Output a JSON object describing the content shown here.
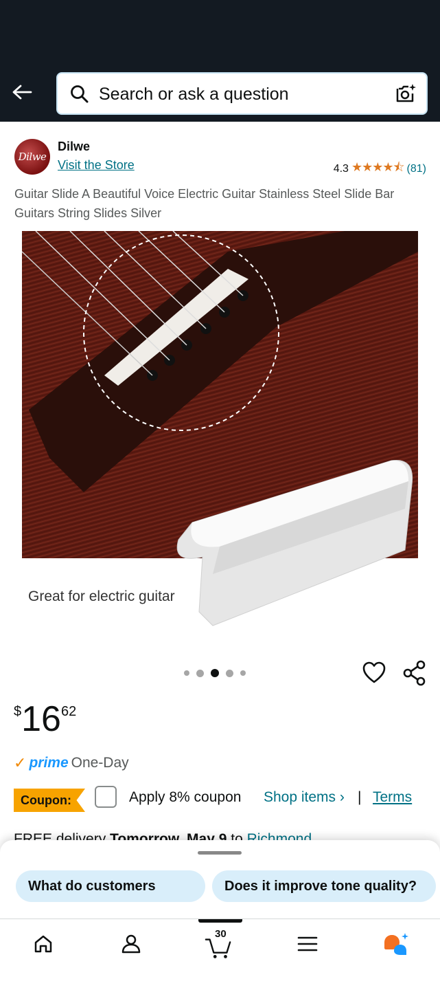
{
  "header": {
    "search_placeholder": "Search or ask a question",
    "icons": [
      "back-arrow-icon",
      "search-icon",
      "camera-icon"
    ]
  },
  "store": {
    "logo_text": "Dilwe",
    "name": "Dilwe",
    "visit_label": "Visit the Store",
    "rating_value": "4.3",
    "stars": "★★★★⯪",
    "rating_count": "(81)"
  },
  "product": {
    "title": "Guitar Slide A Beautiful Voice Electric Guitar Stainless Steel Slide Bar Guitars String Slides Silver",
    "image_caption": "Great for electric guitar",
    "carousel": {
      "total": 5,
      "active_index": 2
    }
  },
  "price": {
    "symbol": "$",
    "whole": "16",
    "fraction": "62"
  },
  "prime": {
    "check": "✓",
    "word": "prime",
    "tier": "One-Day"
  },
  "coupon": {
    "badge": "Coupon:",
    "apply_text": "Apply 8% coupon",
    "shop_items": "Shop items ›",
    "separator": "|",
    "terms": "Terms"
  },
  "delivery": {
    "prefix": "FREE delivery ",
    "date": "Tomorrow, May 9",
    "to": " to ",
    "location": "Richmond"
  },
  "suggestions": {
    "chip1": "What do customers",
    "chip2": "Does it improve tone quality?"
  },
  "bottom_nav": {
    "cart_count": "30",
    "items": [
      "home-icon",
      "account-icon",
      "cart-icon",
      "menu-icon",
      "rufus-icon"
    ]
  },
  "colors": {
    "header_bg": "#131a22",
    "link": "#007185",
    "star": "#de7921",
    "coupon": "#f7a300",
    "prime_blue": "#1a98ff",
    "chip_bg": "#d9eefa"
  }
}
